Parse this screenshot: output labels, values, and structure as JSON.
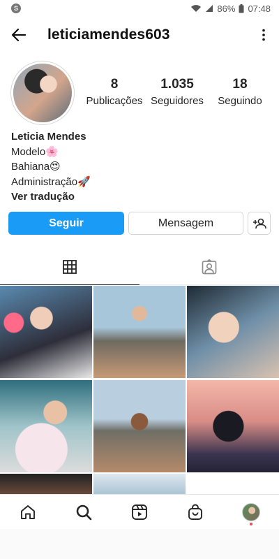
{
  "status_bar": {
    "badge": "S",
    "battery": "86%",
    "time": "07:48"
  },
  "header": {
    "username": "leticiamendes603"
  },
  "stats": {
    "posts_count": "8",
    "posts_label": "Publicações",
    "followers_count": "1.035",
    "followers_label": "Seguidores",
    "following_count": "18",
    "following_label": "Seguindo"
  },
  "bio": {
    "name": "Leticia Mendes",
    "line1": "Modelo🌸",
    "line2": "Bahiana😍",
    "line3": "Administração🚀",
    "translate": "Ver tradução"
  },
  "actions": {
    "follow_label": "Seguir",
    "message_label": "Mensagem"
  },
  "icons": {
    "back": "back-arrow-icon",
    "more": "more-vertical-icon",
    "add_person": "add-person-icon",
    "grid": "grid-icon",
    "tagged": "tagged-person-icon",
    "home": "home-icon",
    "search": "search-icon",
    "reels": "reels-icon",
    "shop": "shop-icon"
  },
  "colors": {
    "accent_blue": "#1a9bf5",
    "notification_dot": "#ed4956",
    "text": "#262626"
  }
}
